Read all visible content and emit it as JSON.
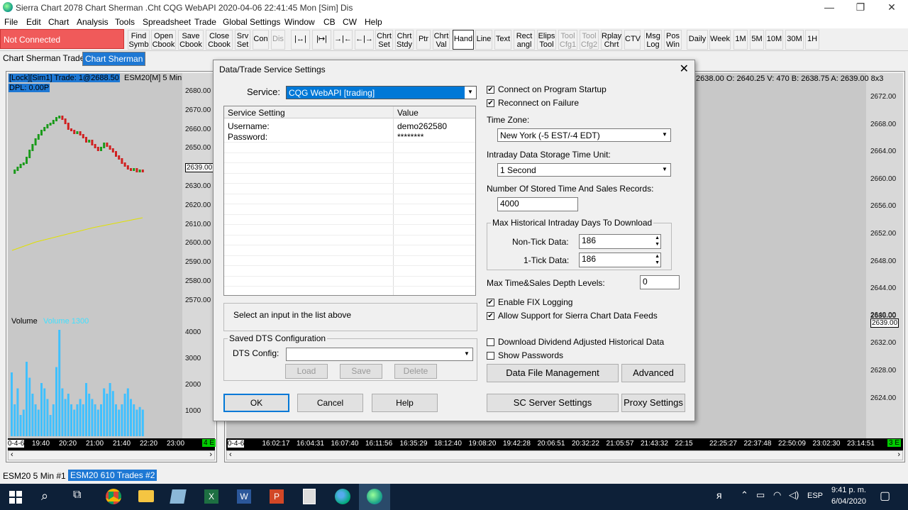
{
  "window": {
    "title": "Sierra Chart 2078 Chart Sherman .Cht  CQG WebAPI 2020-04-06  22:41:45 Mon [Sim]  Dis",
    "minimize": "—",
    "maximize": "❐",
    "close": "✕"
  },
  "menu": [
    "File",
    "Edit",
    "Chart",
    "Analysis",
    "Tools",
    "Spreadsheet",
    "Trade",
    "Global Settings",
    "Window",
    "CB",
    "CW",
    "Help"
  ],
  "connection_status": "Not Connected",
  "toolbar": [
    {
      "l1": "Find",
      "l2": "Symb"
    },
    {
      "l1": "Open",
      "l2": "Cbook"
    },
    {
      "l1": "Save",
      "l2": "Cbook"
    },
    {
      "l1": "Close",
      "l2": "Cbook"
    },
    {
      "l1": "Srv",
      "l2": "Set"
    },
    {
      "l1": "Con",
      "l2": ""
    },
    {
      "l1": "Dis",
      "l2": ""
    },
    {
      "l1": "|↔|",
      "l2": ""
    },
    {
      "l1": "|↦|",
      "l2": ""
    },
    {
      "l1": "→|←",
      "l2": ""
    },
    {
      "l1": "←|→",
      "l2": ""
    },
    {
      "l1": "Chrt",
      "l2": "Set"
    },
    {
      "l1": "Chrt",
      "l2": "Stdy"
    },
    {
      "l1": "Ptr",
      "l2": ""
    },
    {
      "l1": "Chrt",
      "l2": "Val"
    },
    {
      "l1": "Hand",
      "l2": ""
    },
    {
      "l1": "Line",
      "l2": ""
    },
    {
      "l1": "Text",
      "l2": ""
    },
    {
      "l1": "Rect",
      "l2": "angl"
    },
    {
      "l1": "Elips",
      "l2": "Tool"
    },
    {
      "l1": "Tool",
      "l2": "Cfg1"
    },
    {
      "l1": "Tool",
      "l2": "Cfg2"
    },
    {
      "l1": "Rplay",
      "l2": "Chrt"
    },
    {
      "l1": "CTV",
      "l2": ""
    },
    {
      "l1": "Msg",
      "l2": "Log"
    },
    {
      "l1": "Pos",
      "l2": "Win"
    },
    {
      "l1": "Daily",
      "l2": ""
    },
    {
      "l1": "Week",
      "l2": ""
    },
    {
      "l1": "1M",
      "l2": ""
    },
    {
      "l1": "5M",
      "l2": ""
    },
    {
      "l1": "10M",
      "l2": ""
    },
    {
      "l1": "30M",
      "l2": ""
    },
    {
      "l1": "1H",
      "l2": ""
    }
  ],
  "tabs": [
    "Chart Sherman Trader",
    "Chart Sherman"
  ],
  "left_chart": {
    "header": "[Lock][Sim1]  Trade: 1@2688.50",
    "symbol": "ESM20[M]  5 Min",
    "dpl": "DPL: 0.00P",
    "prices": [
      "2680.00",
      "2670.00",
      "2660.00",
      "2650.00",
      "2639.00",
      "2630.00",
      "2620.00",
      "2610.00",
      "2600.00",
      "2590.00",
      "2580.00",
      "2570.00"
    ],
    "volume_label": "Volume",
    "volume_value": "Volume 1300",
    "volumes": [
      "4000",
      "3000",
      "2000",
      "1000"
    ],
    "times": [
      "0-4-6",
      "19:40",
      "20:20",
      "21:00",
      "21:40",
      "22:20",
      "23:00"
    ],
    "corner": "4 E"
  },
  "right_chart": {
    "header": "2638.00 O: 2640.25 V: 470 B: 2638.75 A: 2639.00 8x3",
    "prices": [
      "2672.00",
      "2668.00",
      "2664.00",
      "2660.00",
      "2656.00",
      "2652.00",
      "2648.00",
      "2644.00",
      "2640.00",
      "2639.00",
      "2636.00",
      "2632.00",
      "2628.00",
      "2624.00"
    ],
    "times": [
      "0-4-6",
      "16:02:17",
      "16:04:31",
      "16:07:40",
      "16:11:56",
      "16:35:29",
      "18:12:40",
      "19:08:20",
      "19:42:28",
      "20:06:51",
      "20:32:22",
      "21:05:57",
      "21:43:32",
      "22:15",
      "22:25:27",
      "22:37:48",
      "22:50:09",
      "23:02:30",
      "23:14:51"
    ],
    "corner": "3 E"
  },
  "dialog": {
    "title": "Data/Trade Service Settings",
    "service_label": "Service:",
    "service_value": "CQG WebAPI   [trading]",
    "table_headers": [
      "Service Setting",
      "Value"
    ],
    "table_rows": [
      [
        "Username:",
        "demo262580"
      ],
      [
        "Password:",
        "********"
      ]
    ],
    "hint": "Select an input in the list above",
    "saved_group": "Saved DTS Configuration",
    "dts_label": "DTS Config:",
    "dts_value": "",
    "load": "Load",
    "save": "Save",
    "delete": "Delete",
    "ok": "OK",
    "cancel": "Cancel",
    "help": "Help",
    "connect_startup": "Connect on Program Startup",
    "reconnect": "Reconnect on Failure",
    "tz_label": "Time Zone:",
    "tz_value": "New York (-5 EST/-4 EDT)",
    "storage_label": "Intraday Data Storage Time Unit:",
    "storage_value": "1 Second",
    "records_label": "Number Of Stored Time And Sales Records:",
    "records_value": "4000",
    "hist_group": "Max Historical Intraday Days To Download",
    "nontick_label": "Non-Tick Data:",
    "nontick_value": "186",
    "tick_label": "1-Tick Data:",
    "tick_value": "186",
    "depth_label": "Max Time&Sales Depth Levels:",
    "depth_value": "0",
    "fix": "Enable FIX Logging",
    "allow_support": "Allow Support for Sierra Chart Data Feeds",
    "dividend": "Download Dividend Adjusted Historical Data",
    "show_pw": "Show Passwords",
    "data_mgmt": "Data File Management",
    "advanced": "Advanced",
    "sc_server": "SC Server Settings",
    "proxy": "Proxy Settings",
    "checked": "✔"
  },
  "statusbar": {
    "left": "ESM20  5 Min   #1",
    "right": "ESM20  610 Trades  #2"
  },
  "taskbar": {
    "lang": "ESP",
    "time": "9:41 p. m.",
    "date": "6/04/2020"
  },
  "colors": {
    "accent": "#1e78d4",
    "not_connected": "#f05a5a",
    "candle_up": "#1a9a1a",
    "candle_down": "#d02020",
    "ma": "#e0e000",
    "volume": "#40c0ff"
  }
}
